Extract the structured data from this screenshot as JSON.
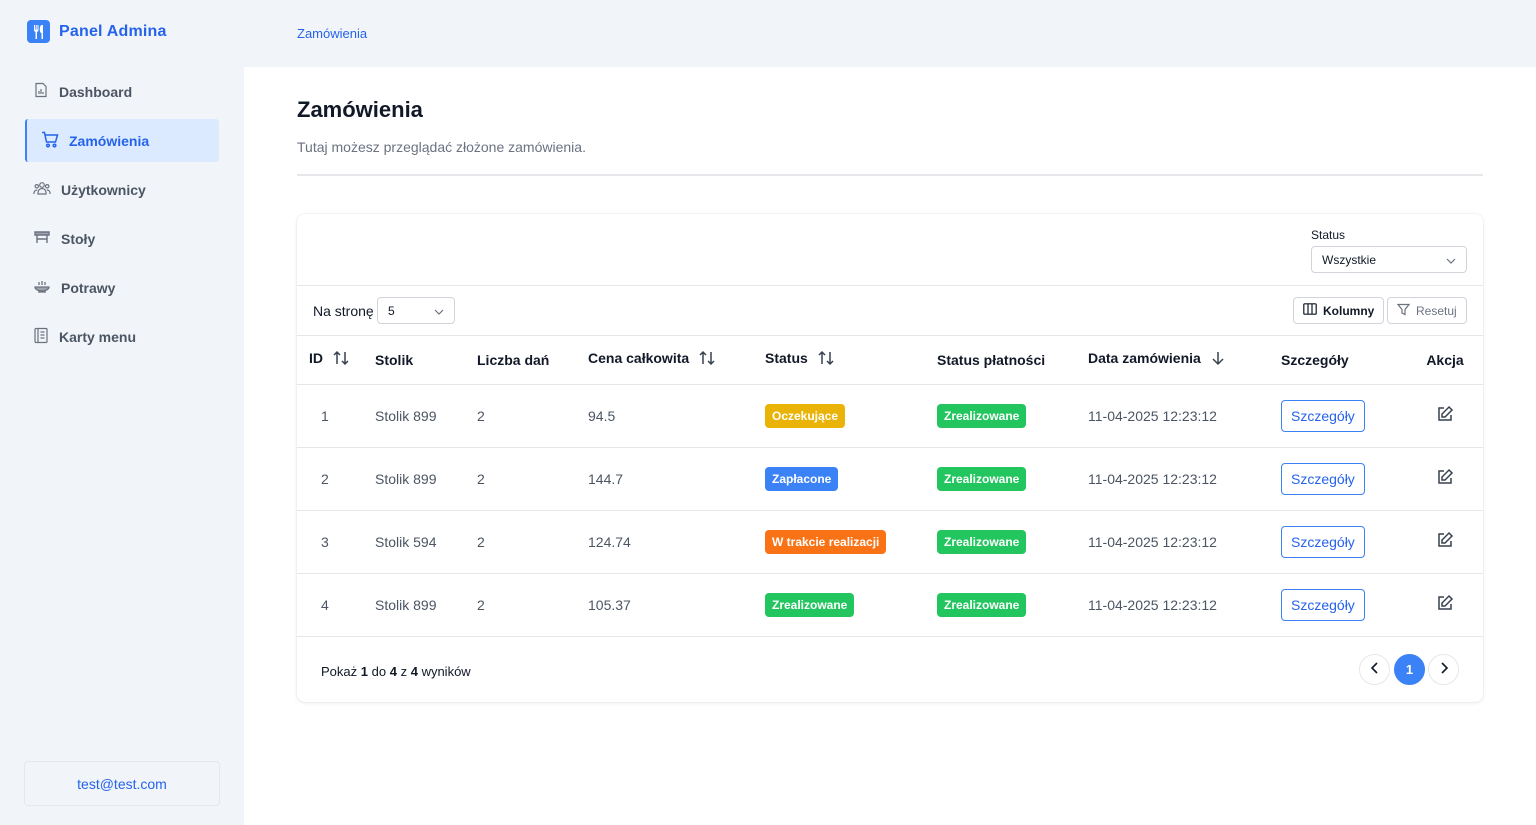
{
  "app": {
    "title": "Panel Admina"
  },
  "sidebar": {
    "items": [
      {
        "label": "Dashboard",
        "icon": "dashboard-icon",
        "active": false
      },
      {
        "label": "Zamówienia",
        "icon": "cart-icon",
        "active": true
      },
      {
        "label": "Użytkownicy",
        "icon": "users-icon",
        "active": false
      },
      {
        "label": "Stoły",
        "icon": "table-icon",
        "active": false
      },
      {
        "label": "Potrawy",
        "icon": "dish-icon",
        "active": false
      },
      {
        "label": "Karty menu",
        "icon": "menu-card-icon",
        "active": false
      }
    ],
    "user_email": "test@test.com"
  },
  "header": {
    "breadcrumb": "Zamówienia"
  },
  "page": {
    "title": "Zamówienia",
    "subtitle": "Tutaj możesz przeglądać złożone zamówienia."
  },
  "filters": {
    "status_label": "Status",
    "status_value": "Wszystkie"
  },
  "toolbar": {
    "per_page_label": "Na stronę",
    "per_page_value": "5",
    "columns_label": "Kolumny",
    "reset_label": "Resetuj"
  },
  "table": {
    "headers": [
      "ID",
      "Stolik",
      "Liczba dań",
      "Cena całkowita",
      "Status",
      "Status płatności",
      "Data zamówienia",
      "Szczegóły",
      "Akcja"
    ],
    "details_label": "Szczegóły",
    "rows": [
      {
        "id": "1",
        "table": "Stolik 899",
        "dishes": "2",
        "total": "94.5",
        "status": "Oczekujące",
        "status_color": "#eab308",
        "payment": "Zrealizowane",
        "payment_color": "#22c55e",
        "date": "11-04-2025 12:23:12"
      },
      {
        "id": "2",
        "table": "Stolik 899",
        "dishes": "2",
        "total": "144.7",
        "status": "Zapłacone",
        "status_color": "#3b82f6",
        "payment": "Zrealizowane",
        "payment_color": "#22c55e",
        "date": "11-04-2025 12:23:12"
      },
      {
        "id": "3",
        "table": "Stolik 594",
        "dishes": "2",
        "total": "124.74",
        "status": "W trakcie realizacji",
        "status_color": "#f97316",
        "payment": "Zrealizowane",
        "payment_color": "#22c55e",
        "date": "11-04-2025 12:23:12"
      },
      {
        "id": "4",
        "table": "Stolik 899",
        "dishes": "2",
        "total": "105.37",
        "status": "Zrealizowane",
        "status_color": "#22c55e",
        "payment": "Zrealizowane",
        "payment_color": "#22c55e",
        "date": "11-04-2025 12:23:12"
      }
    ]
  },
  "pagination": {
    "prefix": "Pokaż",
    "from": "1",
    "to_word": "do",
    "to": "4",
    "of_word": "z",
    "total": "4",
    "suffix": "wyników",
    "current_page": "1"
  },
  "colors": {
    "accent": "#3b82f6",
    "accent_text": "#2563eb",
    "active_bg": "#dbeafe"
  }
}
